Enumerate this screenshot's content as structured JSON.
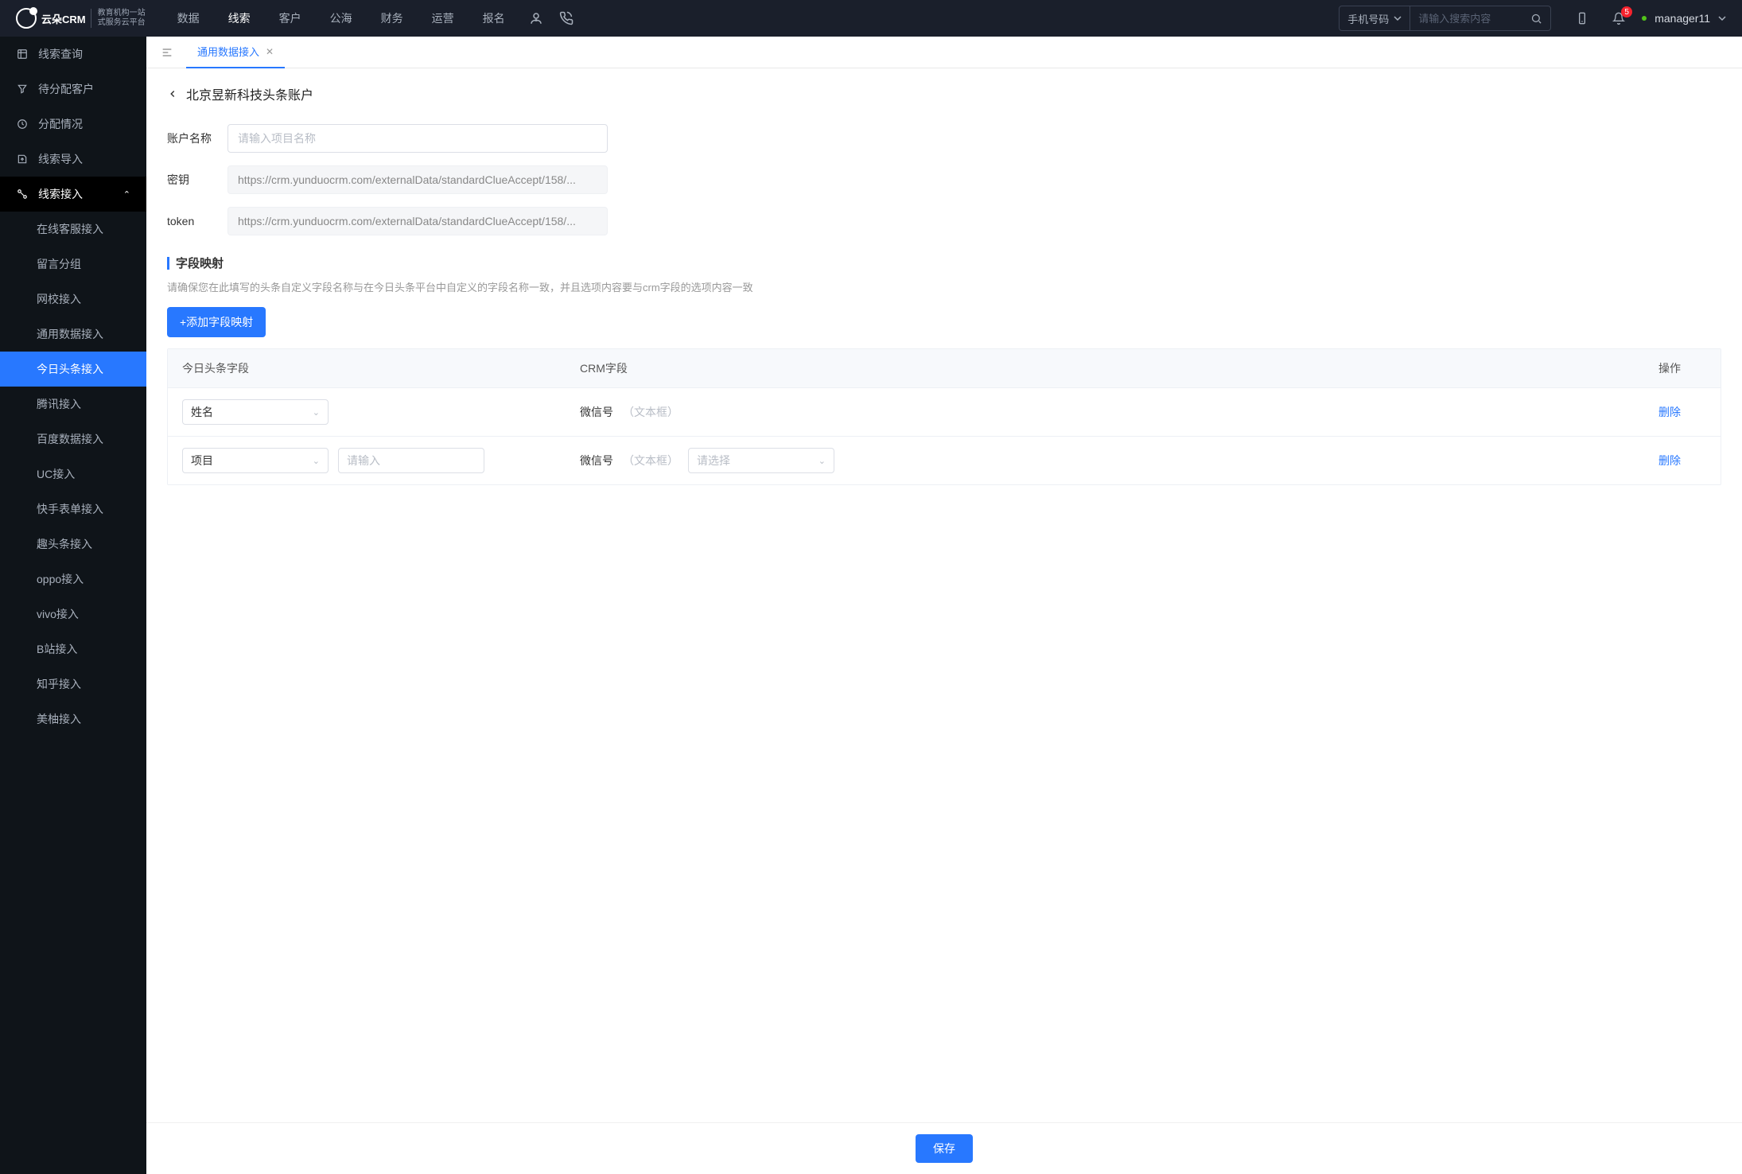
{
  "logo": {
    "brand": "云朵CRM",
    "sub1": "教育机构一站",
    "sub2": "式服务云平台"
  },
  "topnav": [
    "数据",
    "线索",
    "客户",
    "公海",
    "财务",
    "运营",
    "报名"
  ],
  "topnav_active": 1,
  "search": {
    "type_label": "手机号码",
    "placeholder": "请输入搜索内容"
  },
  "badge_count": "5",
  "username": "manager11",
  "sidebar": {
    "items": [
      {
        "label": "线索查询"
      },
      {
        "label": "待分配客户"
      },
      {
        "label": "分配情况"
      },
      {
        "label": "线索导入"
      }
    ],
    "group_label": "线索接入",
    "subs": [
      "在线客服接入",
      "留言分组",
      "网校接入",
      "通用数据接入",
      "今日头条接入",
      "腾讯接入",
      "百度数据接入",
      "UC接入",
      "快手表单接入",
      "趣头条接入",
      "oppo接入",
      "vivo接入",
      "B站接入",
      "知乎接入",
      "美柚接入"
    ],
    "active_sub": 4
  },
  "tab": {
    "label": "通用数据接入"
  },
  "page": {
    "title": "北京昱新科技头条账户",
    "account_label": "账户名称",
    "account_placeholder": "请输入项目名称",
    "secret_label": "密钥",
    "secret_value": "https://crm.yunduocrm.com/externalData/standardClueAccept/158/...",
    "token_label": "token",
    "token_value": "https://crm.yunduocrm.com/externalData/standardClueAccept/158/..."
  },
  "mapping": {
    "title": "字段映射",
    "hint": "请确保您在此填写的头条自定义字段名称与在今日头条平台中自定义的字段名称一致，并且选项内容要与crm字段的选项内容一致",
    "add_button": "+添加字段映射",
    "headers": {
      "c1": "今日头条字段",
      "c2": "CRM字段",
      "c3": "操作"
    },
    "rows": [
      {
        "select1": "姓名",
        "has_input": false,
        "crm_label": "微信号",
        "crm_type": "（文本框）",
        "has_select2": false,
        "action": "删除"
      },
      {
        "select1": "项目",
        "has_input": true,
        "input_ph": "请输入",
        "crm_label": "微信号",
        "crm_type": "（文本框）",
        "has_select2": true,
        "select2_ph": "请选择",
        "action": "删除"
      }
    ]
  },
  "save_label": "保存"
}
